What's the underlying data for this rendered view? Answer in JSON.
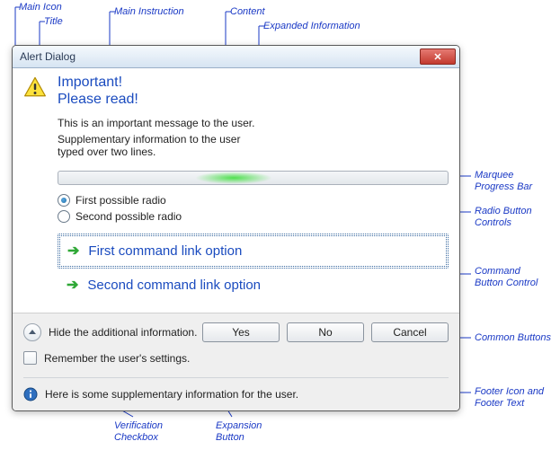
{
  "annotations": {
    "main_icon": "Main Icon",
    "title": "Title",
    "main_instruction": "Main Instruction",
    "content": "Content",
    "expanded_information": "Expanded Information",
    "marquee": "Marquee\nProgress Bar",
    "radios": "Radio Button\nControls",
    "command_btn": "Command\nButton Control",
    "common_buttons": "Common Buttons",
    "footer": "Footer Icon and\nFooter Text",
    "verification": "Verification\nCheckbox",
    "expansion": "Expansion\nButton"
  },
  "dialog": {
    "title": "Alert Dialog",
    "main_instruction_line1": "Important!",
    "main_instruction_line2": "Please read!",
    "content_text": "This is an important message to the user.",
    "expanded_line1": "Supplementary information to the user",
    "expanded_line2": "typed over two lines.",
    "radios": [
      {
        "label": "First possible radio",
        "checked": true
      },
      {
        "label": "Second possible radio",
        "checked": false
      }
    ],
    "commands": [
      "First command link option",
      "Second command link option"
    ],
    "expansion_label": "Hide the additional information.",
    "verification_label": "Remember the user's settings.",
    "buttons": {
      "yes": "Yes",
      "no": "No",
      "cancel": "Cancel"
    },
    "footer_text": "Here is some supplementary information for the user."
  }
}
